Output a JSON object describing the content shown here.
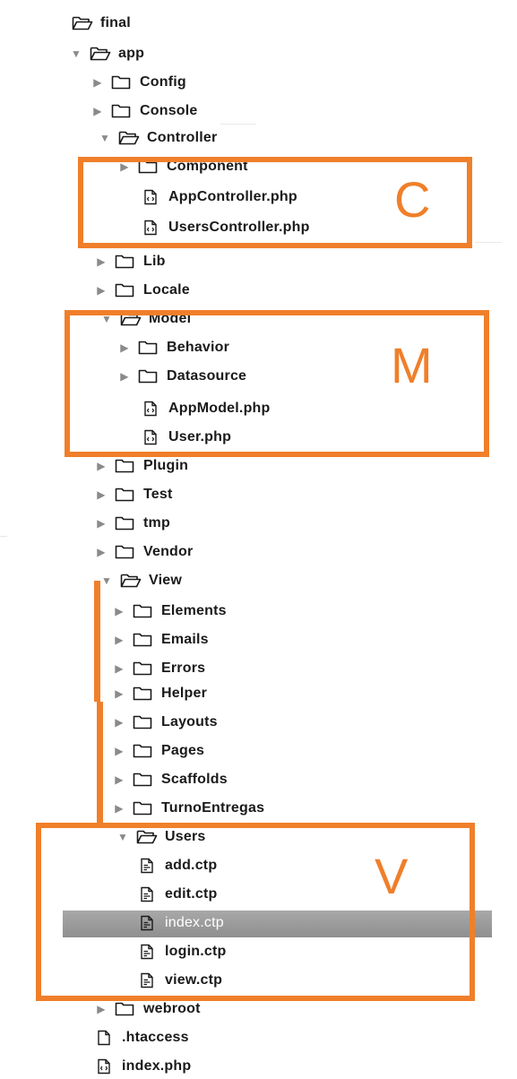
{
  "colors": {
    "highlight": "#f07f2a",
    "selected_row": "#9a9a9a",
    "arrow": "#8a8a8a"
  },
  "annotations": {
    "controller_letter": "C",
    "model_letter": "M",
    "view_letter": "V"
  },
  "tree": [
    {
      "label": "final",
      "type": "folder",
      "open": true,
      "level": 0
    },
    {
      "label": "app",
      "type": "folder",
      "open": true,
      "level": 1
    },
    {
      "label": "Config",
      "type": "folder",
      "open": false,
      "level": 2
    },
    {
      "label": "Console",
      "type": "folder",
      "open": false,
      "level": 2
    },
    {
      "label": "Controller",
      "type": "folder",
      "open": true,
      "level": 2
    },
    {
      "label": "Component",
      "type": "folder",
      "open": false,
      "level": 3
    },
    {
      "label": "AppController.php",
      "type": "file",
      "level": 4
    },
    {
      "label": "UsersController.php",
      "type": "file",
      "level": 4
    },
    {
      "label": "Lib",
      "type": "folder",
      "open": false,
      "level": 2
    },
    {
      "label": "Locale",
      "type": "folder",
      "open": false,
      "level": 2
    },
    {
      "label": "Model",
      "type": "folder",
      "open": true,
      "level": 2
    },
    {
      "label": "Behavior",
      "type": "folder",
      "open": false,
      "level": 3
    },
    {
      "label": "Datasource",
      "type": "folder",
      "open": false,
      "level": 3
    },
    {
      "label": "AppModel.php",
      "type": "file",
      "level": 4
    },
    {
      "label": "User.php",
      "type": "file",
      "level": 4
    },
    {
      "label": "Plugin",
      "type": "folder",
      "open": false,
      "level": 2
    },
    {
      "label": "Test",
      "type": "folder",
      "open": false,
      "level": 2
    },
    {
      "label": "tmp",
      "type": "folder",
      "open": false,
      "level": 2
    },
    {
      "label": "Vendor",
      "type": "folder",
      "open": false,
      "level": 2
    },
    {
      "label": "View",
      "type": "folder",
      "open": true,
      "level": 2
    },
    {
      "label": "Elements",
      "type": "folder",
      "open": false,
      "level": 3
    },
    {
      "label": "Emails",
      "type": "folder",
      "open": false,
      "level": 3
    },
    {
      "label": "Errors",
      "type": "folder",
      "open": false,
      "level": 3
    },
    {
      "label": "Helper",
      "type": "folder",
      "open": false,
      "level": 3
    },
    {
      "label": "Layouts",
      "type": "folder",
      "open": false,
      "level": 3
    },
    {
      "label": "Pages",
      "type": "folder",
      "open": false,
      "level": 3
    },
    {
      "label": "Scaffolds",
      "type": "folder",
      "open": false,
      "level": 3
    },
    {
      "label": "TurnoEntregas",
      "type": "folder",
      "open": false,
      "level": 3
    },
    {
      "label": "Users",
      "type": "folder",
      "open": true,
      "level": 3
    },
    {
      "label": "add.ctp",
      "type": "ctp",
      "level": 4
    },
    {
      "label": "edit.ctp",
      "type": "ctp",
      "level": 4
    },
    {
      "label": "index.ctp",
      "type": "ctp",
      "level": 4,
      "selected": true
    },
    {
      "label": "login.ctp",
      "type": "ctp",
      "level": 4
    },
    {
      "label": "view.ctp",
      "type": "ctp",
      "level": 4
    },
    {
      "label": "webroot",
      "type": "folder",
      "open": false,
      "level": 2
    },
    {
      "label": ".htaccess",
      "type": "plain",
      "level": 3
    },
    {
      "label": "index.php",
      "type": "file",
      "level": 3
    }
  ]
}
